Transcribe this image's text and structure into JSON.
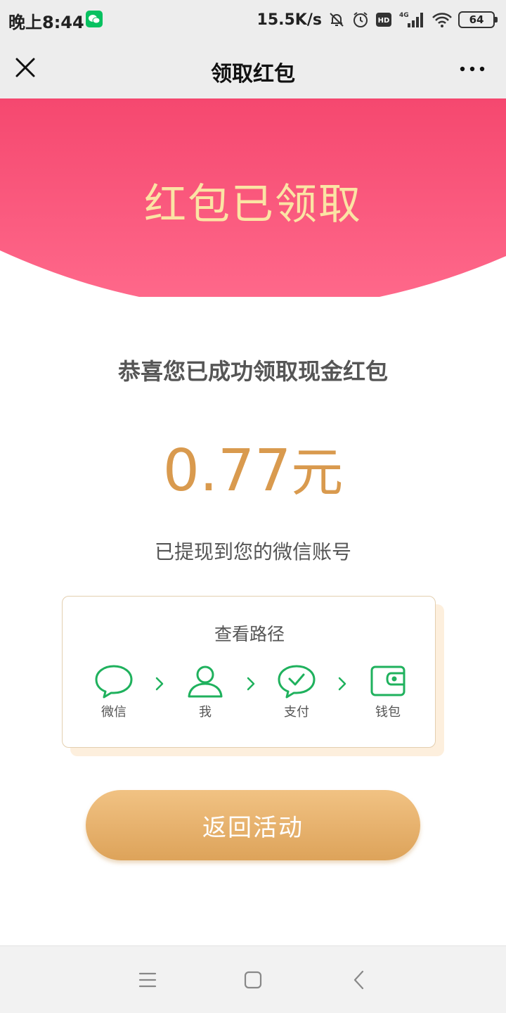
{
  "status_bar": {
    "time": "晚上8:44",
    "network_speed": "15.5K/s",
    "hd_badge": "HD",
    "signal_type": "4G",
    "battery": "64"
  },
  "title_bar": {
    "title": "领取红包"
  },
  "banner": {
    "title": "红包已领取"
  },
  "result": {
    "congrats": "恭喜您已成功领取现金红包",
    "amount": "0.77",
    "amount_unit": "元",
    "withdrawn_note": "已提现到您的微信账号"
  },
  "path_card": {
    "title": "查看路径",
    "steps": [
      {
        "label": "微信",
        "icon": "chat-bubble-icon"
      },
      {
        "label": "我",
        "icon": "person-icon"
      },
      {
        "label": "支付",
        "icon": "pay-check-icon"
      },
      {
        "label": "钱包",
        "icon": "wallet-icon"
      }
    ]
  },
  "actions": {
    "return_label": "返回活动"
  },
  "colors": {
    "banner_top": "#f5486f",
    "banner_bottom": "#ff6a8c",
    "banner_text": "#fbe4a4",
    "amount": "#d99a4e",
    "icon_green": "#1fb15d",
    "button_top": "#f1c283",
    "button_bottom": "#dda35a"
  }
}
